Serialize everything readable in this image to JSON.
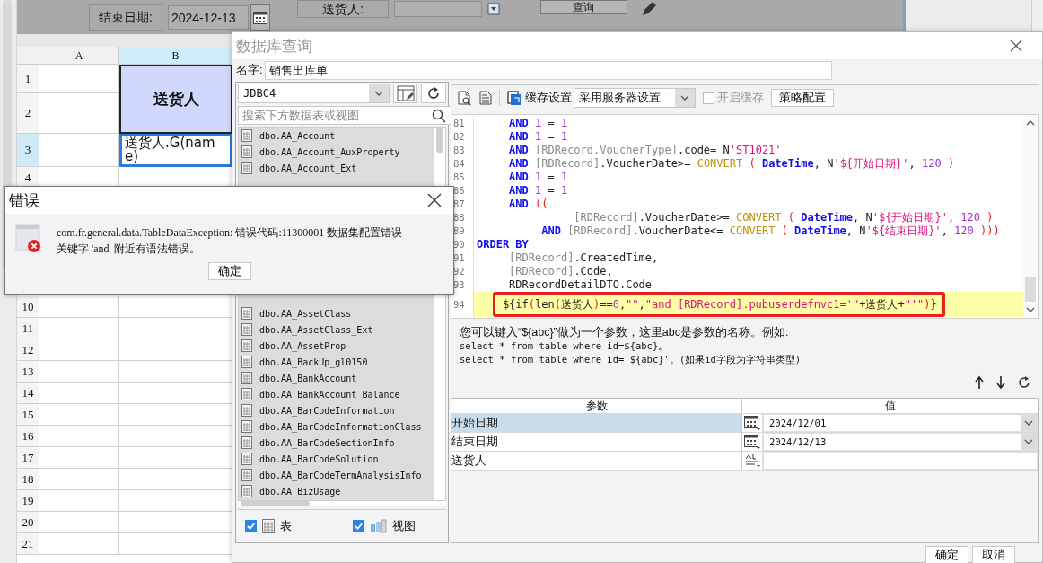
{
  "form": {
    "fields": [
      {
        "label": "结束日期:",
        "value": "2024-12-13",
        "kind": "date"
      },
      {
        "label": "送货人:",
        "kind": "text"
      }
    ],
    "button": "查询"
  },
  "sheet": {
    "columns": [
      {
        "label": "A",
        "selected": false
      },
      {
        "label": "B",
        "selected": true
      }
    ],
    "rows": [
      {
        "label": "1",
        "selected": false
      },
      {
        "label": "2",
        "selected": false
      },
      {
        "label": "3",
        "selected": true
      },
      {
        "label": "4",
        "selected": false
      },
      {
        "label": "10",
        "selected": false
      },
      {
        "label": "11",
        "selected": false
      },
      {
        "label": "12",
        "selected": false
      },
      {
        "label": "13",
        "selected": false
      },
      {
        "label": "14",
        "selected": false
      },
      {
        "label": "15",
        "selected": false
      },
      {
        "label": "16",
        "selected": false
      },
      {
        "label": "17",
        "selected": false
      },
      {
        "label": "18",
        "selected": false
      },
      {
        "label": "19",
        "selected": false
      },
      {
        "label": "20",
        "selected": false
      },
      {
        "label": "21",
        "selected": false
      }
    ],
    "cells": [
      {
        "kind": "header",
        "text": "送货人"
      },
      {
        "kind": "formula",
        "text": "送货人.G(name)",
        "selected": true
      }
    ]
  },
  "query_dialog": {
    "title": "数据库查询",
    "name_label": "名字:",
    "name_value": "销售出库单",
    "connection": "JDBC4",
    "search_placeholder": "搜索下方数据表或视图",
    "tables": [
      {
        "kind": "table",
        "name": "dbo.AA_Account"
      },
      {
        "kind": "table",
        "name": "dbo.AA_Account_AuxProperty"
      },
      {
        "kind": "table",
        "name": "dbo.AA_Account_Ext"
      },
      {
        "kind": "covered"
      },
      {
        "kind": "covered"
      },
      {
        "kind": "covered"
      },
      {
        "kind": "covered"
      },
      {
        "kind": "covered"
      },
      {
        "kind": "covered"
      },
      {
        "kind": "covered"
      },
      {
        "kind": "covered"
      },
      {
        "kind": "table",
        "name": "dbo.AA_AssetClass"
      },
      {
        "kind": "table",
        "name": "dbo.AA_AssetClass_Ext"
      },
      {
        "kind": "table",
        "name": "dbo.AA_AssetProp"
      },
      {
        "kind": "table",
        "name": "dbo.AA_BackUp_gl0150"
      },
      {
        "kind": "table",
        "name": "dbo.AA_BankAccount"
      },
      {
        "kind": "table",
        "name": "dbo.AA_BankAccount_Balance"
      },
      {
        "kind": "table",
        "name": "dbo.AA_BarCodeInformation"
      },
      {
        "kind": "table",
        "name": "dbo.AA_BarCodeInformationClass"
      },
      {
        "kind": "table",
        "name": "dbo.AA_BarCodeSectionInfo"
      },
      {
        "kind": "table",
        "name": "dbo.AA_BarCodeSolution"
      },
      {
        "kind": "table",
        "name": "dbo.AA_BarCodeTermAnalysisInfo"
      },
      {
        "kind": "table",
        "name": "dbo.AA_BizUsage"
      }
    ],
    "filters": [
      {
        "kind": "table",
        "label": "表",
        "checked": true
      },
      {
        "kind": "view",
        "label": "视图",
        "checked": true
      }
    ],
    "cache_label": "缓存设置",
    "cache_mode": "采用服务器设置",
    "cache_enable": {
      "label": "开启缓存",
      "checked": false
    },
    "strategy_button": "策略配置",
    "sql_lines": [
      {
        "number": "81",
        "current": false,
        "tokens": [
          {
            "kind": "keyword",
            "text": "     AND"
          },
          {
            "kind": "number",
            "text": " 1"
          },
          {
            "kind": "plain",
            "text": " = "
          },
          {
            "kind": "number",
            "text": "1"
          }
        ]
      },
      {
        "number": "82",
        "current": false,
        "tokens": [
          {
            "kind": "keyword",
            "text": "     AND"
          },
          {
            "kind": "number",
            "text": " 1"
          },
          {
            "kind": "plain",
            "text": " = "
          },
          {
            "kind": "number",
            "text": "1"
          }
        ]
      },
      {
        "number": "83",
        "current": false,
        "tokens": [
          {
            "kind": "keyword",
            "text": "     AND"
          },
          {
            "kind": "ident",
            "text": " [RDRecord.VoucherType]"
          },
          {
            "kind": "plain",
            "text": ".code= N"
          },
          {
            "kind": "string",
            "text": "'ST1021'"
          }
        ]
      },
      {
        "number": "84",
        "current": false,
        "tokens": [
          {
            "kind": "keyword",
            "text": "     AND"
          },
          {
            "kind": "ident",
            "text": " [RDRecord]"
          },
          {
            "kind": "plain",
            "text": ".VoucherDate>= "
          },
          {
            "kind": "function",
            "text": "CONVERT"
          },
          {
            "kind": "paren",
            "text": " ("
          },
          {
            "kind": "keyword",
            "text": " DateTime"
          },
          {
            "kind": "plain",
            "text": ", N"
          },
          {
            "kind": "string",
            "text": "'${开始日期}'"
          },
          {
            "kind": "plain",
            "text": ", "
          },
          {
            "kind": "number",
            "text": "120"
          },
          {
            "kind": "paren",
            "text": " )"
          }
        ]
      },
      {
        "number": "85",
        "current": false,
        "tokens": [
          {
            "kind": "keyword",
            "text": "     AND"
          },
          {
            "kind": "number",
            "text": " 1"
          },
          {
            "kind": "plain",
            "text": " = "
          },
          {
            "kind": "number",
            "text": "1"
          }
        ]
      },
      {
        "number": "86",
        "current": false,
        "tokens": [
          {
            "kind": "keyword",
            "text": "     AND"
          },
          {
            "kind": "number",
            "text": " 1"
          },
          {
            "kind": "plain",
            "text": " = "
          },
          {
            "kind": "number",
            "text": "1"
          }
        ]
      },
      {
        "number": "87",
        "current": false,
        "tokens": [
          {
            "kind": "keyword",
            "text": "     AND"
          },
          {
            "kind": "paren",
            "text": " (("
          }
        ]
      },
      {
        "number": "88",
        "current": false,
        "tokens": [
          {
            "kind": "ident",
            "text": "               [RDRecord]"
          },
          {
            "kind": "plain",
            "text": ".VoucherDate>= "
          },
          {
            "kind": "function",
            "text": "CONVERT"
          },
          {
            "kind": "paren",
            "text": " ("
          },
          {
            "kind": "keyword",
            "text": " DateTime"
          },
          {
            "kind": "plain",
            "text": ", N"
          },
          {
            "kind": "string",
            "text": "'${开始日期}'"
          },
          {
            "kind": "plain",
            "text": ", "
          },
          {
            "kind": "number",
            "text": "120"
          },
          {
            "kind": "paren",
            "text": " )"
          }
        ]
      },
      {
        "number": "89",
        "current": false,
        "tokens": [
          {
            "kind": "keyword",
            "text": "          AND"
          },
          {
            "kind": "ident",
            "text": " [RDRecord]"
          },
          {
            "kind": "plain",
            "text": ".VoucherDate<= "
          },
          {
            "kind": "function",
            "text": "CONVERT"
          },
          {
            "kind": "paren",
            "text": " ("
          },
          {
            "kind": "keyword",
            "text": " DateTime"
          },
          {
            "kind": "plain",
            "text": ", N"
          },
          {
            "kind": "string",
            "text": "'${结束日期}'"
          },
          {
            "kind": "plain",
            "text": ", "
          },
          {
            "kind": "number",
            "text": "120"
          },
          {
            "kind": "paren",
            "text": " )))"
          }
        ]
      },
      {
        "number": "90",
        "current": false,
        "tokens": [
          {
            "kind": "keyword",
            "text": "ORDER BY"
          }
        ]
      },
      {
        "number": "91",
        "current": false,
        "tokens": [
          {
            "kind": "ident",
            "text": "     [RDRecord]"
          },
          {
            "kind": "plain",
            "text": ".CreatedTime,"
          }
        ]
      },
      {
        "number": "92",
        "current": false,
        "tokens": [
          {
            "kind": "ident",
            "text": "     [RDRecord]"
          },
          {
            "kind": "plain",
            "text": ".Code,"
          }
        ]
      },
      {
        "number": "93",
        "current": false,
        "tokens": [
          {
            "kind": "plain",
            "text": "     RDRecordDetailDTO.Code"
          }
        ]
      },
      {
        "number": "94",
        "current": true,
        "tokens": [
          {
            "kind": "plain",
            "text": "    ${if"
          },
          {
            "kind": "paren",
            "text": "("
          },
          {
            "kind": "plain",
            "text": "len"
          },
          {
            "kind": "paren",
            "text": "("
          },
          {
            "kind": "plain",
            "text": "送货人"
          },
          {
            "kind": "paren",
            "text": ")"
          },
          {
            "kind": "plain",
            "text": "=="
          },
          {
            "kind": "number",
            "text": "0"
          },
          {
            "kind": "plain",
            "text": ","
          },
          {
            "kind": "string",
            "text": "\"\""
          },
          {
            "kind": "plain",
            "text": ","
          },
          {
            "kind": "string",
            "text": "\"and [RDRecord].pubuserdefnvc1='\""
          },
          {
            "kind": "plain",
            "text": "+送货人+"
          },
          {
            "kind": "string",
            "text": "\"'\""
          },
          {
            "kind": "paren",
            "text": ")"
          },
          {
            "kind": "plain",
            "text": "}"
          }
        ]
      }
    ],
    "annotation": {
      "kind": "rectangle"
    },
    "hint_lines": [
      "您可以键入“${abc}”做为一个参数，这里abc是参数的名称。例如:",
      "select * from table where id=${abc}。",
      "select * from table where id='${abc}'。(如果id字段为字符串类型)"
    ],
    "params": {
      "columns": [
        "参数",
        "值"
      ],
      "rows": [
        {
          "name": "开始日期",
          "kind": "date",
          "value": "2024/12/01",
          "selected": true
        },
        {
          "name": "结束日期",
          "kind": "date",
          "value": "2024/12/13",
          "selected": false
        },
        {
          "name": "送货人",
          "kind": "text",
          "selected": false
        }
      ]
    },
    "buttons": [
      "确定",
      "取消"
    ]
  },
  "error_dialog": {
    "title": "错误",
    "message": "com.fr.general.data.TableDataException: 错误代码:11300001 数据集配置错误关键字 'and' 附近有语法错误。",
    "button": "确定"
  }
}
